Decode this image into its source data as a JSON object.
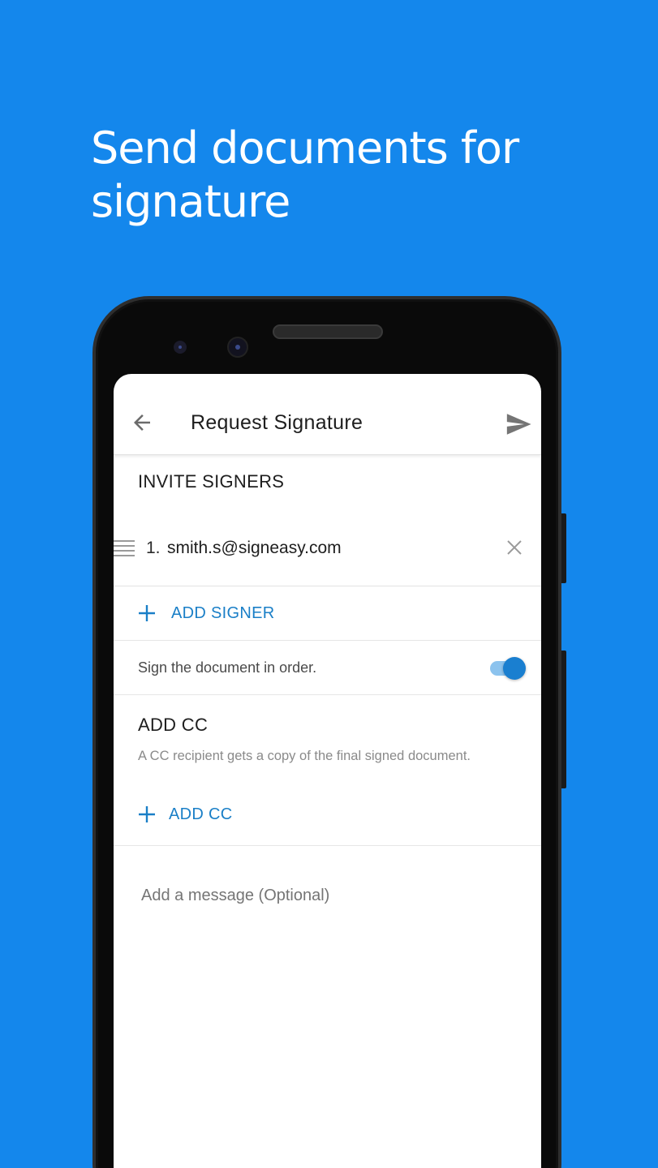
{
  "headline": "Send documents for signature",
  "colors": {
    "background": "#1487ec",
    "accent": "#1a7fc7",
    "toggle_on": "#1a7fd0"
  },
  "appbar": {
    "back_icon": "arrow-left-icon",
    "title": "Request Signature",
    "send_icon": "send-icon"
  },
  "invite": {
    "section_title": "INVITE SIGNERS",
    "signers": [
      {
        "number": "1.",
        "email": "smith.s@signeasy.com"
      }
    ],
    "add_signer_label": "ADD SIGNER"
  },
  "order": {
    "label": "Sign the document in order.",
    "enabled": true
  },
  "cc": {
    "section_title": "ADD CC",
    "description": "A CC recipient gets a copy of the final signed document.",
    "add_cc_label": "ADD CC"
  },
  "message": {
    "placeholder": "Add a message (Optional)"
  }
}
